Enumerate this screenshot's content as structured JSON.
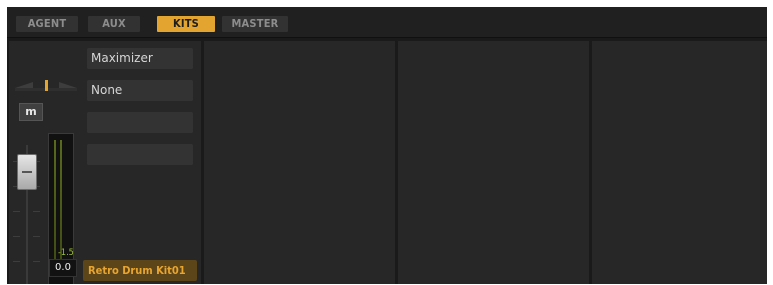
{
  "tabs": [
    {
      "label": "AGENT",
      "active": false
    },
    {
      "label": "AUX",
      "active": false
    },
    {
      "label": "KITS",
      "active": true
    },
    {
      "label": "MASTER",
      "active": false
    }
  ],
  "channel": {
    "mute_label": "m",
    "peak_db": "-1.5",
    "volume_db": "0.0",
    "kit_name": "Retro Drum Kit01",
    "pan_position": "center",
    "insert_slots": [
      "Maximizer",
      "None",
      "",
      ""
    ]
  },
  "colors": {
    "accent": "#e3a52f",
    "background": "#1a1a1a",
    "panel": "#272727",
    "slot": "#333333",
    "meter_green": "#9ec23c",
    "kit_name_text": "#e8a530"
  },
  "icons": {
    "mute": "mute-toggle",
    "fader": "volume-fader",
    "pan": "pan-slider"
  }
}
